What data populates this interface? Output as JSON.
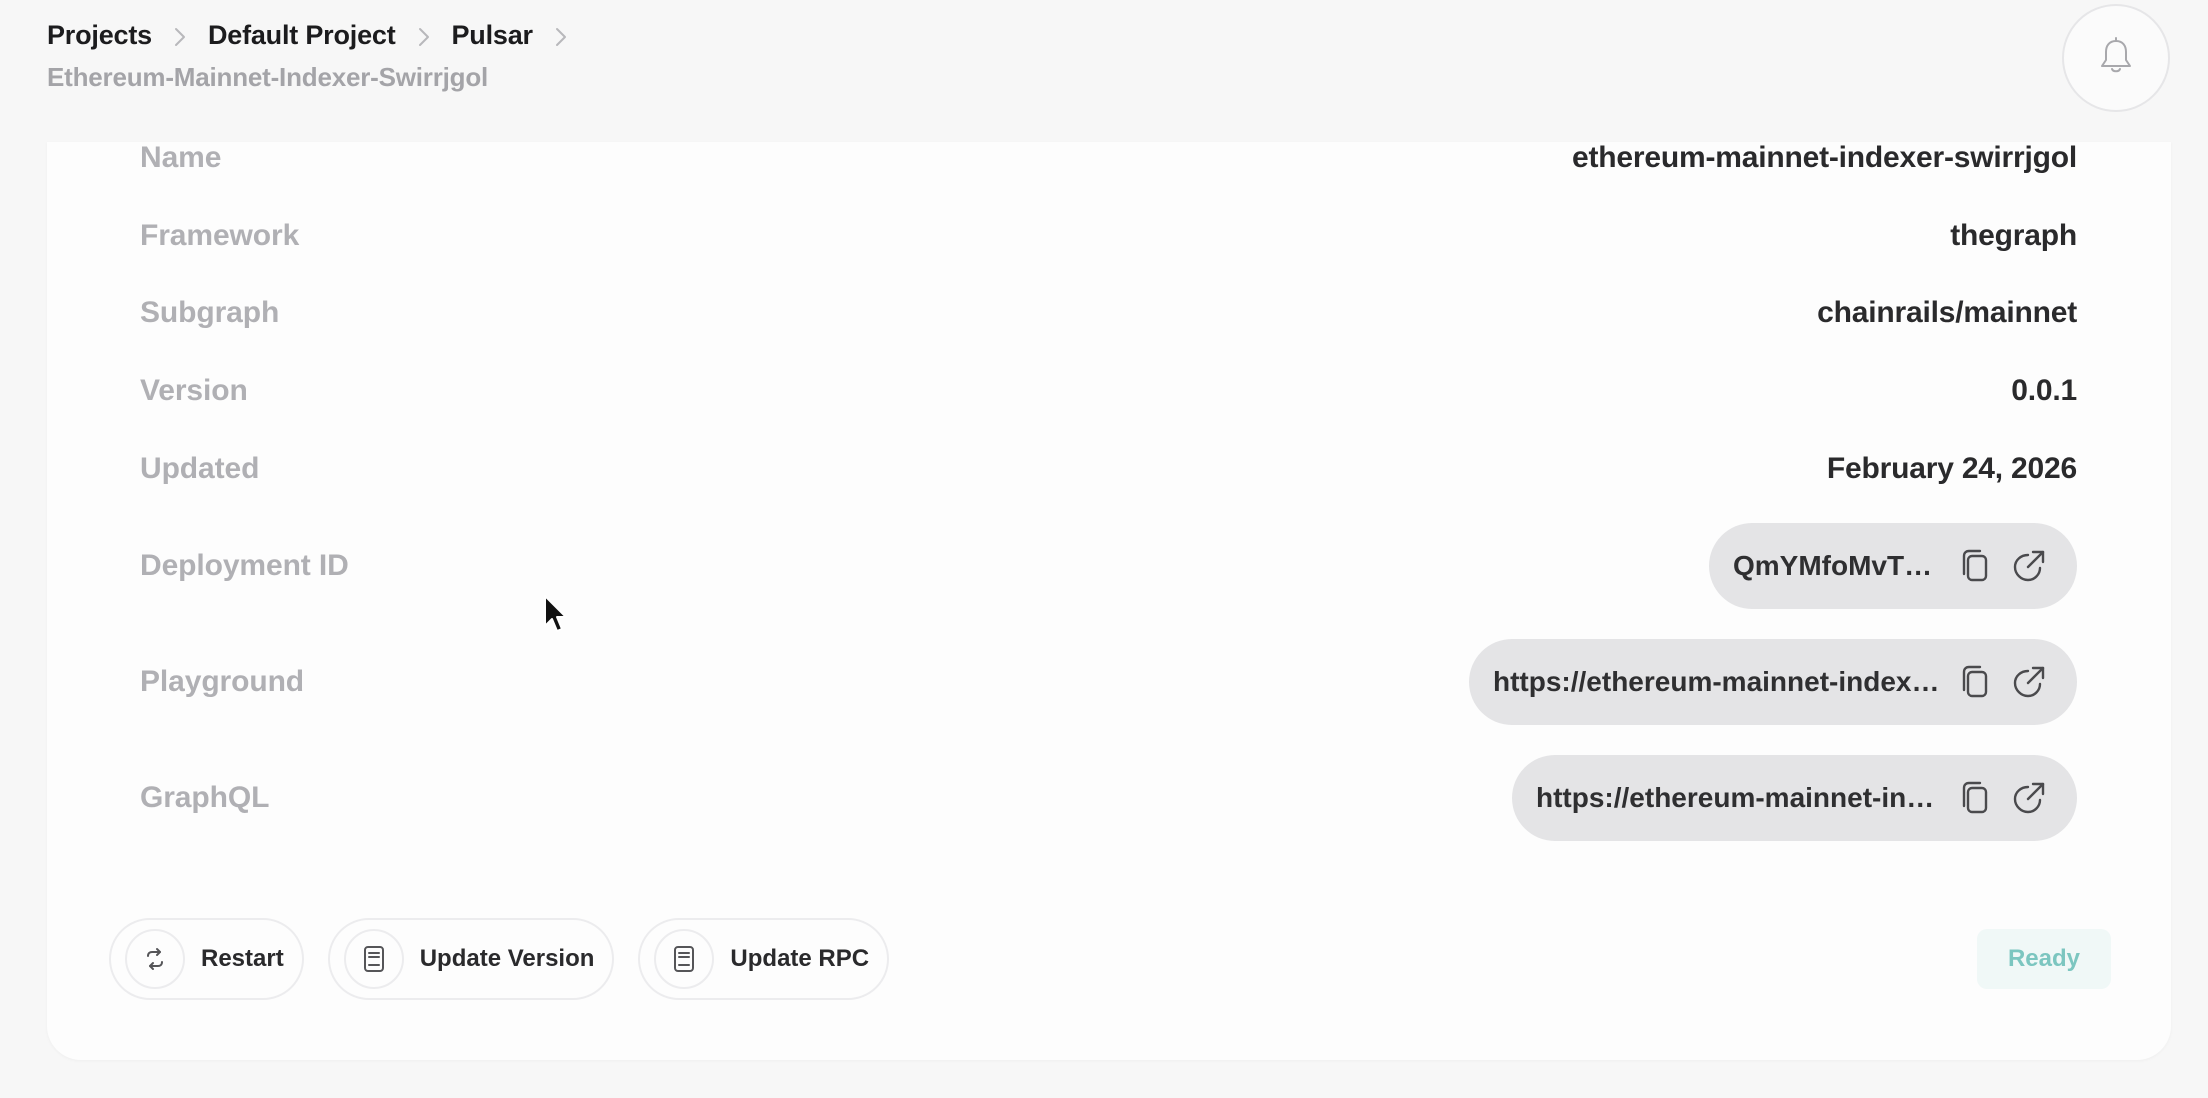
{
  "breadcrumb": {
    "items": [
      "Projects",
      "Default Project",
      "Pulsar"
    ],
    "subtitle": "Ethereum-Mainnet-Indexer-Swirrjgol"
  },
  "header": {
    "notification_icon": "bell-icon"
  },
  "details": {
    "name_label": "Name",
    "name_value": "ethereum-mainnet-indexer-swirrjgol",
    "framework_label": "Framework",
    "framework_value": "thegraph",
    "subgraph_label": "Subgraph",
    "subgraph_value": "chainrails/mainnet",
    "version_label": "Version",
    "version_value": "0.0.1",
    "updated_label": "Updated",
    "updated_value": "February 24, 2026",
    "deployment_label": "Deployment ID",
    "deployment_value": "QmYMfoMvTk...",
    "playground_label": "Playground",
    "playground_value": "https://ethereum-mainnet-indexe...",
    "graphql_label": "GraphQL",
    "graphql_value": "https://ethereum-mainnet-ind..."
  },
  "actions": {
    "restart_label": "Restart",
    "update_version_label": "Update Version",
    "update_rpc_label": "Update RPC"
  },
  "status": {
    "label": "Ready",
    "color": "#7cc6c0"
  },
  "colors": {
    "label_gray": "#b0b0b4",
    "value_dark": "#2a2a2c",
    "pill_bg": "#e4e4e6"
  }
}
